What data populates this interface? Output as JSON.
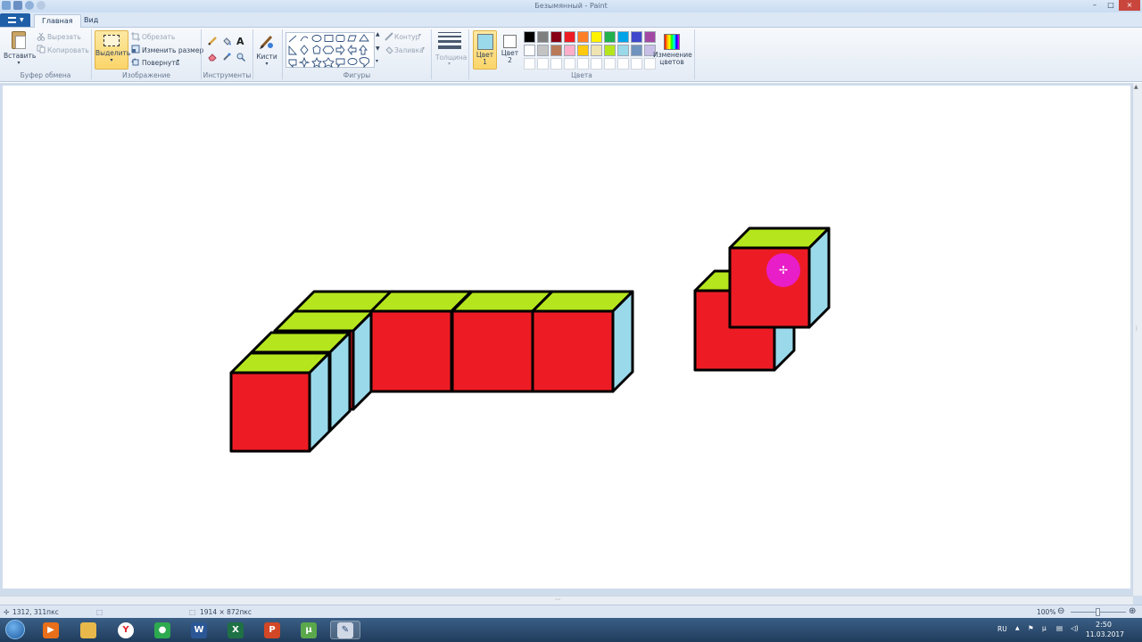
{
  "window": {
    "title": "Безымянный - Paint",
    "controls": [
      "–",
      "□",
      "×"
    ]
  },
  "tabs": [
    {
      "label": "Главная",
      "active": true
    },
    {
      "label": "Вид",
      "active": false
    }
  ],
  "ribbon": {
    "clipboard": {
      "paste_label": "Вставить",
      "cut_label": "Вырезать",
      "copy_label": "Копировать",
      "group_label": "Буфер обмена"
    },
    "image": {
      "select_label": "Выделить",
      "crop_label": "Обрезать",
      "resize_label": "Изменить размер",
      "rotate_label": "Повернуть",
      "group_label": "Изображение"
    },
    "tools": {
      "group_label": "Инструменты"
    },
    "brushes_label": "Кисти",
    "shapes": {
      "outline_label": "Контур",
      "fill_label": "Заливка",
      "group_label": "Фигуры"
    },
    "thickness_label": "Толщина",
    "colors": {
      "color1_label": "Цвет",
      "color1_num": "1",
      "color2_label": "Цвет",
      "color2_num": "2",
      "color1_value": "#99d9ea",
      "color2_value": "#ffffff",
      "edit_label_1": "Изменение",
      "edit_label_2": "цветов",
      "group_label": "Цвета",
      "palette_row1": [
        "#000000",
        "#7f7f7f",
        "#880015",
        "#ed1c24",
        "#ff7f27",
        "#fff200",
        "#22b14c",
        "#00a2e8",
        "#3f48cc",
        "#a349a4"
      ],
      "palette_row2": [
        "#ffffff",
        "#c3c3c3",
        "#b97a57",
        "#ffaec9",
        "#ffc90e",
        "#efe4b0",
        "#b5e61d",
        "#99d9ea",
        "#7092be",
        "#c8bfe7"
      ]
    }
  },
  "drawing": {
    "cube_front": "#ed1c24",
    "cube_top": "#b5e61d",
    "cube_side": "#99d9ea",
    "outline": "#000000",
    "cursor_highlight": "#e81ec8"
  },
  "status": {
    "cursor_pos": "1312, 311пкс",
    "image_size": "1914 × 872пкс",
    "zoom": "100%"
  },
  "taskbar": {
    "apps": [
      {
        "icon": "media-player-icon",
        "color": "#e96f1a",
        "glyph": "▶"
      },
      {
        "icon": "explorer-icon",
        "color": "#e8b94a",
        "glyph": ""
      },
      {
        "icon": "yandex-browser-icon",
        "color": "#ffffff",
        "glyph": "Y"
      },
      {
        "icon": "chrome-icon",
        "color": "#2da94f",
        "glyph": "●"
      },
      {
        "icon": "word-icon",
        "color": "#2b5797",
        "glyph": "W"
      },
      {
        "icon": "excel-icon",
        "color": "#1e7145",
        "glyph": "X"
      },
      {
        "icon": "powerpoint-icon",
        "color": "#d24726",
        "glyph": "P"
      },
      {
        "icon": "utorrent-icon",
        "color": "#5ba84c",
        "glyph": "µ"
      },
      {
        "icon": "paint-icon",
        "color": "#d0d8e6",
        "glyph": "✎"
      }
    ],
    "lang": "RU",
    "time": "2:50",
    "date": "11.03.2017"
  }
}
